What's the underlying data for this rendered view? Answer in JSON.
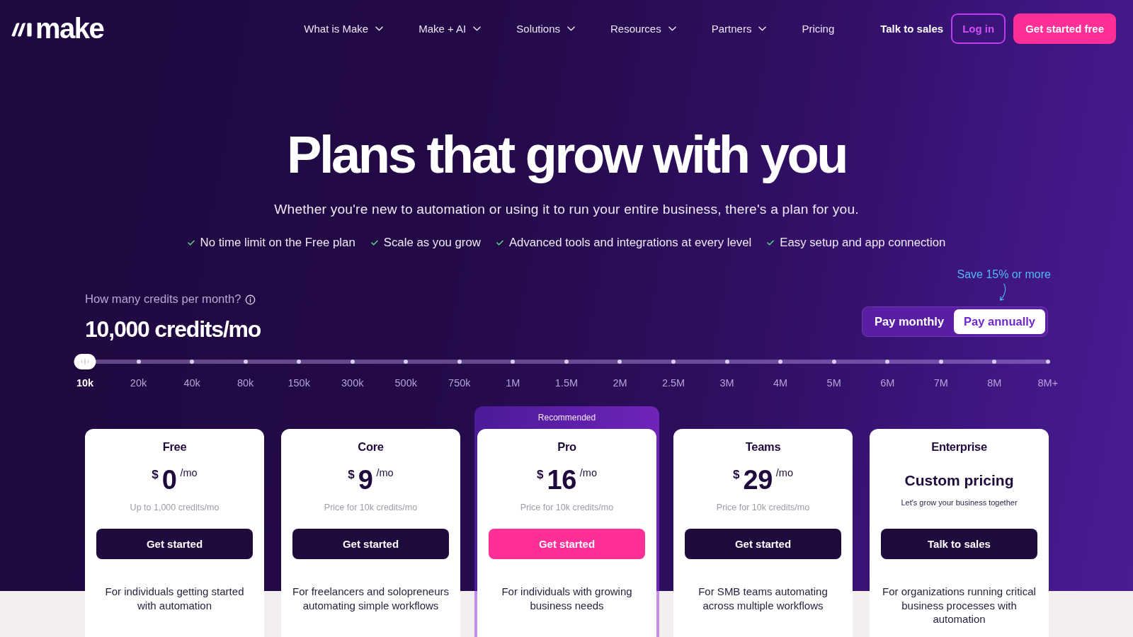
{
  "header": {
    "logo": {
      "text": "make"
    },
    "nav": [
      {
        "label": "What is Make",
        "dropdown": true
      },
      {
        "label": "Make + AI",
        "dropdown": true
      },
      {
        "label": "Solutions",
        "dropdown": true
      },
      {
        "label": "Resources",
        "dropdown": true
      },
      {
        "label": "Partners",
        "dropdown": true
      },
      {
        "label": "Pricing",
        "dropdown": false
      }
    ],
    "actions": [
      {
        "kind": "link",
        "label": "Talk to sales"
      },
      {
        "kind": "outline",
        "label": "Log in"
      },
      {
        "kind": "primary",
        "label": "Get started free"
      }
    ]
  },
  "hero": {
    "title": "Plans that grow with you",
    "subtitle": "Whether you're new to automation or using it to run your entire business, there's a plan for you.",
    "features": [
      "No time limit on the Free plan",
      "Scale as you grow",
      "Advanced tools and integrations at every level",
      "Easy setup and app connection"
    ]
  },
  "credits": {
    "label": "How many credits per month?",
    "value": "10,000 credits/mo",
    "slider": {
      "level": 0,
      "ticks": [
        {
          "label": "10k",
          "selected": true
        },
        {
          "label": "20k",
          "selected": false
        },
        {
          "label": "40k",
          "selected": false
        },
        {
          "label": "80k",
          "selected": false
        },
        {
          "label": "150k",
          "selected": false
        },
        {
          "label": "300k",
          "selected": false
        },
        {
          "label": "500k",
          "selected": false
        },
        {
          "label": "750k",
          "selected": false
        },
        {
          "label": "1M",
          "selected": false
        },
        {
          "label": "1.5M",
          "selected": false
        },
        {
          "label": "2M",
          "selected": false
        },
        {
          "label": "2.5M",
          "selected": false
        },
        {
          "label": "3M",
          "selected": false
        },
        {
          "label": "4M",
          "selected": false
        },
        {
          "label": "5M",
          "selected": false
        },
        {
          "label": "6M",
          "selected": false
        },
        {
          "label": "7M",
          "selected": false
        },
        {
          "label": "8M",
          "selected": false
        },
        {
          "label": "8M+",
          "selected": false
        }
      ]
    }
  },
  "billing": {
    "note": "Save 15% or more",
    "options": [
      {
        "label": "Pay monthly",
        "selected": false
      },
      {
        "label": "Pay annually",
        "selected": true
      }
    ]
  },
  "plans": [
    {
      "name": "Free",
      "kind": "priced",
      "recommended": false,
      "price": {
        "currency": "$",
        "amount": "0",
        "period": "/mo"
      },
      "note": "Up to 1,000 credits/mo",
      "button": "Get started",
      "description": "For individuals getting started with automation"
    },
    {
      "name": "Core",
      "kind": "priced",
      "recommended": false,
      "price": {
        "currency": "$",
        "amount": "9",
        "period": "/mo"
      },
      "note": "Price for 10k credits/mo",
      "button": "Get started",
      "description": "For freelancers and solopreneurs automating simple workflows"
    },
    {
      "name": "Pro",
      "kind": "priced",
      "recommended": true,
      "badge": "Recommended",
      "price": {
        "currency": "$",
        "amount": "16",
        "period": "/mo"
      },
      "note": "Price for 10k credits/mo",
      "button": "Get started",
      "description": "For individuals with growing business needs"
    },
    {
      "name": "Teams",
      "kind": "priced",
      "recommended": false,
      "price": {
        "currency": "$",
        "amount": "29",
        "period": "/mo"
      },
      "note": "Price for 10k credits/mo",
      "button": "Get started",
      "description": "For SMB teams automating across multiple workflows"
    },
    {
      "name": "Enterprise",
      "kind": "custom",
      "recommended": false,
      "price_text": "Custom pricing",
      "note": "Let's grow your business together",
      "button": "Talk to sales",
      "description": "For organizations running critical business processes with automation"
    }
  ]
}
